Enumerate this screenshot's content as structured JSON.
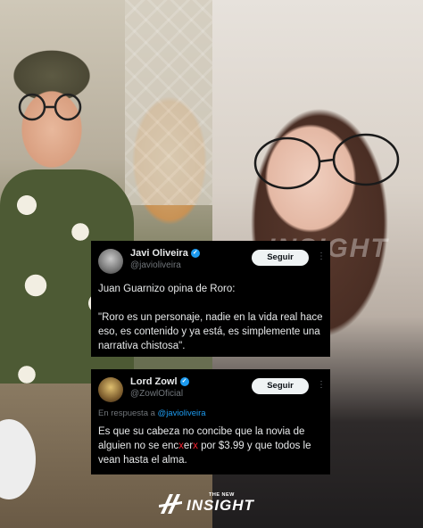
{
  "colors": {
    "card_bg": "#000000",
    "text": "#e7e9ea",
    "muted": "#71767b",
    "link": "#1d9bf0",
    "follow_bg": "#eff3f4",
    "censor": "#f4212e"
  },
  "watermark": {
    "text": "INSIGHT"
  },
  "tweet1": {
    "display_name": "Javi Oliveira",
    "handle": "@javioliveira",
    "follow_label": "Seguir",
    "more_icon": "more-dots-icon",
    "line1": "Juan Guarnizo opina de Roro:",
    "quote": "\"Roro es un personaje, nadie en la vida real hace eso, es contenido y ya está, es simplemente una narrativa chistosa\"."
  },
  "tweet2": {
    "display_name": "Lord Zowl",
    "handle": "@ZowlOficial",
    "follow_label": "Seguir",
    "more_icon": "more-dots-icon",
    "reply_prefix": "En respuesta a",
    "reply_handle": "@javioliveira",
    "text_part1": "Es que su cabeza no concibe que la novia de alguien no se enc",
    "censor1": "x",
    "text_part2": "er",
    "censor2": "x",
    "text_part3": " por $3.99 y que todos le vean hasta el alma."
  },
  "logo": {
    "small": "THE NEW",
    "big": "INSIGHT"
  }
}
